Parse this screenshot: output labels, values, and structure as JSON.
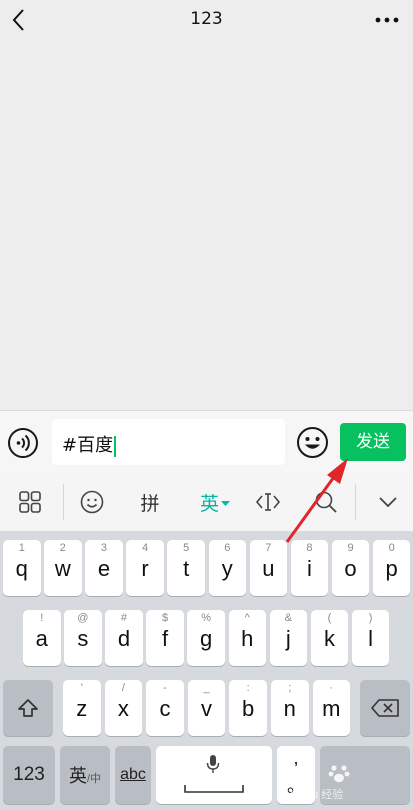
{
  "header": {
    "title": "123"
  },
  "composer": {
    "input_value": "#百度",
    "send_label": "发送"
  },
  "ime_toolbar": {
    "pinyin_label": "拼",
    "english_label": "英",
    "active_color": "#07b6a4"
  },
  "keyboard": {
    "row1": [
      {
        "hint": "1",
        "key": "q"
      },
      {
        "hint": "2",
        "key": "w"
      },
      {
        "hint": "3",
        "key": "e"
      },
      {
        "hint": "4",
        "key": "r"
      },
      {
        "hint": "5",
        "key": "t"
      },
      {
        "hint": "6",
        "key": "y"
      },
      {
        "hint": "7",
        "key": "u"
      },
      {
        "hint": "8",
        "key": "i"
      },
      {
        "hint": "9",
        "key": "o"
      },
      {
        "hint": "0",
        "key": "p"
      }
    ],
    "row2": [
      {
        "hint": "!",
        "key": "a"
      },
      {
        "hint": "@",
        "key": "s"
      },
      {
        "hint": "#",
        "key": "d"
      },
      {
        "hint": "$",
        "key": "f"
      },
      {
        "hint": "%",
        "key": "g"
      },
      {
        "hint": "^",
        "key": "h"
      },
      {
        "hint": "&",
        "key": "j"
      },
      {
        "hint": "(",
        "key": "k"
      },
      {
        "hint": ")",
        "key": "l"
      }
    ],
    "row3": [
      {
        "hint": "'",
        "key": "z"
      },
      {
        "hint": "/",
        "key": "x"
      },
      {
        "hint": "-",
        "key": "c"
      },
      {
        "hint": "_",
        "key": "v"
      },
      {
        "hint": ":",
        "key": "b"
      },
      {
        "hint": ";",
        "key": "n"
      },
      {
        "hint": "·",
        "key": "m"
      }
    ],
    "numbers_label": "123",
    "lang_label": "英",
    "lang_sub_label": "/中",
    "abc_label": "abc",
    "comma_label": ",",
    "period_label": "。"
  },
  "watermark": "Baidu 经验",
  "colors": {
    "accent_green": "#07c160",
    "arrow_red": "#e0262a"
  }
}
